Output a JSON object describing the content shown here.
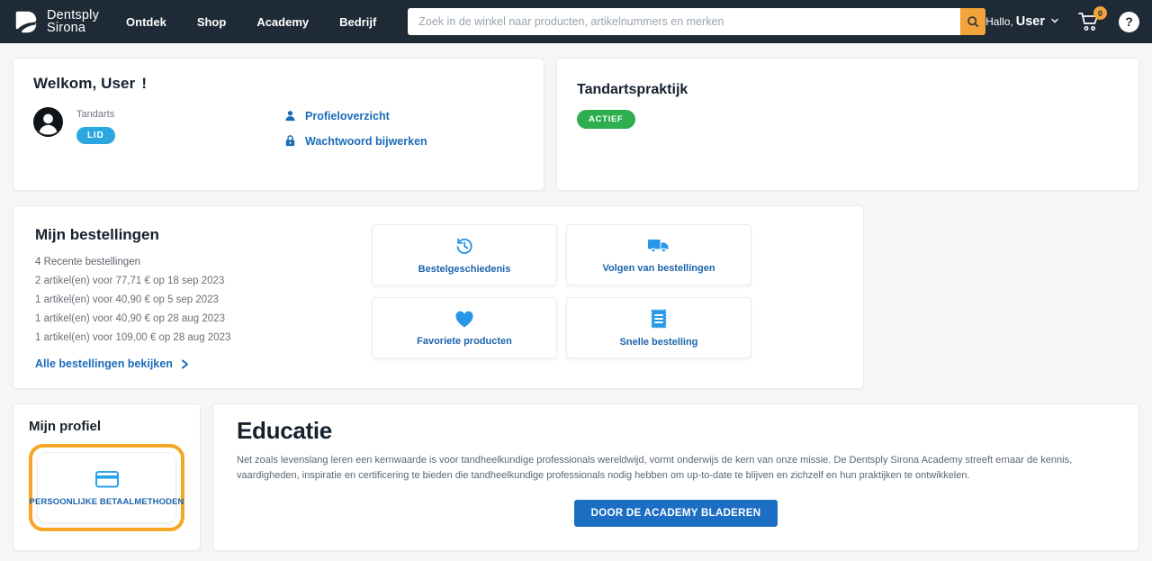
{
  "navbar": {
    "brand": {
      "line1": "Dentsply",
      "line2": "Sirona"
    },
    "links": [
      {
        "label": "Ontdek"
      },
      {
        "label": "Shop"
      },
      {
        "label": "Academy"
      },
      {
        "label": "Bedrijf"
      }
    ],
    "search": {
      "placeholder": "Zoek in de winkel naar producten, artikelnummers en merken"
    },
    "user": {
      "greeting": "Hallo,",
      "name": "User"
    },
    "cart_badge": "0",
    "help_glyph": "?"
  },
  "welcome_card": {
    "title_prefix": "Welkom,",
    "title_name": "User",
    "title_suffix": "!",
    "role": "Tandarts",
    "badge": "LID",
    "links": [
      {
        "label": "Profieloverzicht"
      },
      {
        "label": "Wachtwoord bijwerken"
      }
    ]
  },
  "practice_card": {
    "title": "Tandartspraktijk",
    "status": "ACTIEF"
  },
  "orders": {
    "title": "Mijn bestellingen",
    "subtitle": "4 Recente bestellingen",
    "lines": [
      "2 artikel(en) voor 77,71 € op 18 sep 2023",
      "1 artikel(en) voor 40,90 € op 5 sep 2023",
      "1 artikel(en) voor 40,90 € op 28 aug 2023",
      "1 artikel(en) voor 109,00 € op 28 aug 2023"
    ],
    "view_all": "Alle bestellingen bekijken",
    "tiles": [
      {
        "label": "Bestelgeschiedenis"
      },
      {
        "label": "Volgen van bestellingen"
      },
      {
        "label": "Favoriete producten"
      },
      {
        "label": "Snelle bestelling"
      }
    ]
  },
  "profile": {
    "title": "Mijn profiel",
    "payment_tile_label": "PERSOONLIJKE BETAALMETHODEN"
  },
  "education": {
    "title": "Educatie",
    "body": "Net zoals levenslang leren een kernwaarde is voor tandheelkundige professionals wereldwijd, vormt onderwijs de kern van onze missie. De Dentsply Sirona Academy streeft ernaar de kennis, vaardigheden, inspiratie en certificering te bieden die tandheelkundige professionals nodig hebben om up-to-date te blijven en zichzelf en hun praktijken te ontwikkelen.",
    "cta": "DOOR DE ACADEMY BLADEREN"
  },
  "colors": {
    "navbar": "#1E2A36",
    "accent_orange": "#F2A43A",
    "highlight_ring": "#F5A623",
    "icon_blue": "#2797E8",
    "link_blue": "#1A6CB8",
    "badge_blue": "#2BA7E0",
    "status_green": "#2FAE4F",
    "cta_blue": "#1B6EC2"
  }
}
